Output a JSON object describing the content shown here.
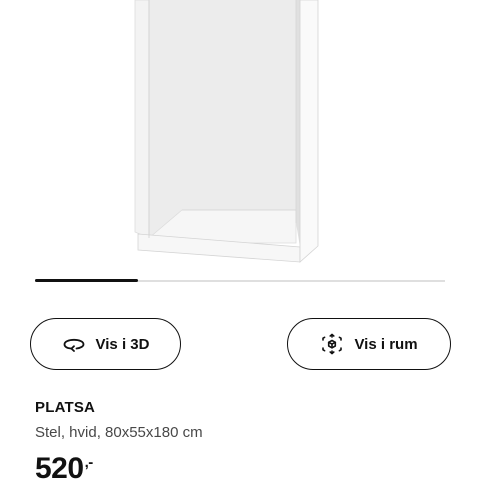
{
  "product": {
    "name": "PLATSA",
    "description": "Stel, hvid, 80x55x180 cm",
    "price": "520",
    "price_suffix": ",-"
  },
  "actions": {
    "view_3d_label": "Vis i 3D",
    "view_room_label": "Vis i rum"
  },
  "carousel": {
    "progress": 0.25
  },
  "icons": {
    "view_3d": "rotate-3d-icon",
    "view_room": "augmented-reality-cube-icon"
  },
  "colors": {
    "text": "#111111",
    "secondary_text": "#484848",
    "track": "#dfdfdf"
  }
}
